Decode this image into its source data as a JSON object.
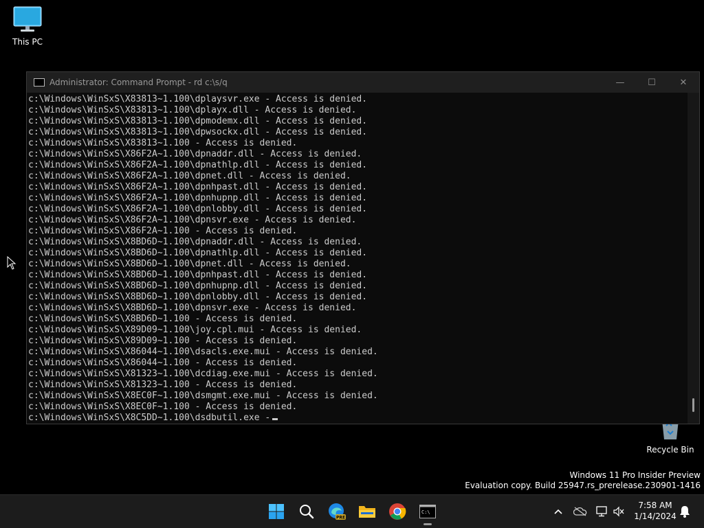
{
  "desktop": {
    "this_pc_label": "This PC",
    "recycle_bin_label": "Recycle Bin"
  },
  "watermark": {
    "line1": "Windows 11 Pro Insider Preview",
    "line2": "Evaluation copy. Build 25947.rs_prerelease.230901-1416"
  },
  "window": {
    "title": "Administrator: Command Prompt - rd  c:\\s/q",
    "minimize_glyph": "—",
    "maximize_glyph": "☐",
    "close_glyph": "✕"
  },
  "console": {
    "lines": [
      "c:\\Windows\\WinSxS\\X83813~1.100\\dplaysvr.exe - Access is denied.",
      "c:\\Windows\\WinSxS\\X83813~1.100\\dplayx.dll - Access is denied.",
      "c:\\Windows\\WinSxS\\X83813~1.100\\dpmodemx.dll - Access is denied.",
      "c:\\Windows\\WinSxS\\X83813~1.100\\dpwsockx.dll - Access is denied.",
      "c:\\Windows\\WinSxS\\X83813~1.100 - Access is denied.",
      "c:\\Windows\\WinSxS\\X86F2A~1.100\\dpnaddr.dll - Access is denied.",
      "c:\\Windows\\WinSxS\\X86F2A~1.100\\dpnathlp.dll - Access is denied.",
      "c:\\Windows\\WinSxS\\X86F2A~1.100\\dpnet.dll - Access is denied.",
      "c:\\Windows\\WinSxS\\X86F2A~1.100\\dpnhpast.dll - Access is denied.",
      "c:\\Windows\\WinSxS\\X86F2A~1.100\\dpnhupnp.dll - Access is denied.",
      "c:\\Windows\\WinSxS\\X86F2A~1.100\\dpnlobby.dll - Access is denied.",
      "c:\\Windows\\WinSxS\\X86F2A~1.100\\dpnsvr.exe - Access is denied.",
      "c:\\Windows\\WinSxS\\X86F2A~1.100 - Access is denied.",
      "c:\\Windows\\WinSxS\\X8BD6D~1.100\\dpnaddr.dll - Access is denied.",
      "c:\\Windows\\WinSxS\\X8BD6D~1.100\\dpnathlp.dll - Access is denied.",
      "c:\\Windows\\WinSxS\\X8BD6D~1.100\\dpnet.dll - Access is denied.",
      "c:\\Windows\\WinSxS\\X8BD6D~1.100\\dpnhpast.dll - Access is denied.",
      "c:\\Windows\\WinSxS\\X8BD6D~1.100\\dpnhupnp.dll - Access is denied.",
      "c:\\Windows\\WinSxS\\X8BD6D~1.100\\dpnlobby.dll - Access is denied.",
      "c:\\Windows\\WinSxS\\X8BD6D~1.100\\dpnsvr.exe - Access is denied.",
      "c:\\Windows\\WinSxS\\X8BD6D~1.100 - Access is denied.",
      "c:\\Windows\\WinSxS\\X89D09~1.100\\joy.cpl.mui - Access is denied.",
      "c:\\Windows\\WinSxS\\X89D09~1.100 - Access is denied.",
      "c:\\Windows\\WinSxS\\X86044~1.100\\dsacls.exe.mui - Access is denied.",
      "c:\\Windows\\WinSxS\\X86044~1.100 - Access is denied.",
      "c:\\Windows\\WinSxS\\X81323~1.100\\dcdiag.exe.mui - Access is denied.",
      "c:\\Windows\\WinSxS\\X81323~1.100 - Access is denied.",
      "c:\\Windows\\WinSxS\\X8EC0F~1.100\\dsmgmt.exe.mui - Access is denied.",
      "c:\\Windows\\WinSxS\\X8EC0F~1.100 - Access is denied.",
      "c:\\Windows\\WinSxS\\X8C5DD~1.100\\dsdbutil.exe -"
    ]
  },
  "taskbar": {
    "icons": [
      "windows-start-icon",
      "search-icon",
      "edge-beta-icon",
      "file-explorer-icon",
      "chrome-icon",
      "command-prompt-icon"
    ],
    "edge_badge": "PRE",
    "cmd_icon_text": "C:\\",
    "tray_chevron": "^",
    "time": "7:58 AM",
    "date": "1/14/2024"
  },
  "colors": {
    "console_text": "#cccccc",
    "console_bg": "#0c0c0c",
    "titlebar_bg": "#1f1f1f",
    "taskbar_bg": "#1c1c1c",
    "accent": "#0078d4"
  }
}
